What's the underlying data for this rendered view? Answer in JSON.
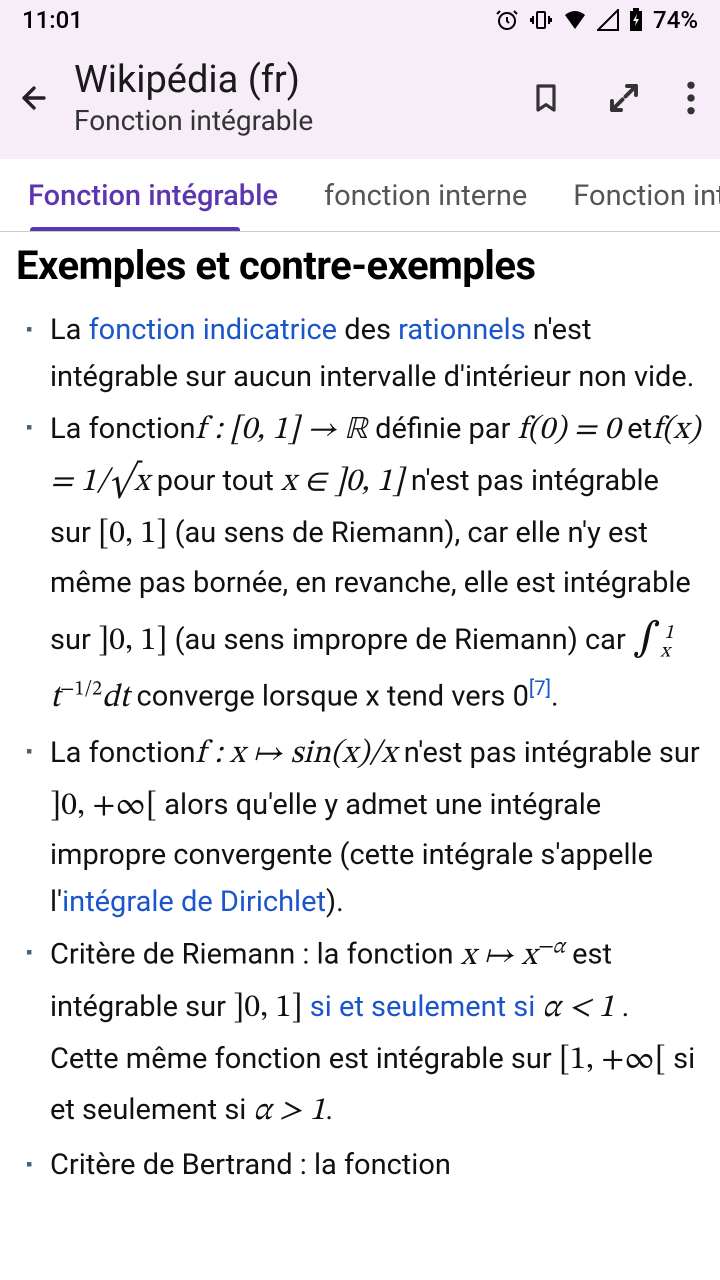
{
  "status": {
    "time": "11:01",
    "battery": "74%"
  },
  "header": {
    "site": "Wikipédia (fr)",
    "page": "Fonction intégrable"
  },
  "tabs": [
    {
      "label": "Fonction intégrable",
      "active": true
    },
    {
      "label": "fonction interne",
      "active": false
    },
    {
      "label": "Fonction intr",
      "active": false
    }
  ],
  "article": {
    "section_title": "Exemples et contre-exemples",
    "items": [
      {
        "pre": "La ",
        "link1": "fonction indicatrice",
        "mid1": " des ",
        "link2": "rationnels",
        "tail": " n'est intégrable sur aucun intervalle d'intérieur non vide."
      },
      {
        "p1": "La fonction",
        "m1": "f : [0, 1] → ℝ",
        "p2": " définie par ",
        "m2": "f(0) = 0",
        "p3": " et",
        "m3": "f(x) = 1/√x",
        "p4": " pour tout ",
        "m4": "x ∈ ]0, 1]",
        "p5": " n'est pas intégrable sur ",
        "m5": "[0, 1]",
        "p6": " (au sens de Riemann), car elle n'y est même pas bornée, en revanche, elle est intégrable sur ",
        "m6": "]0, 1]",
        "p7": " (au sens impropre de Riemann) car ",
        "m7a": "∫",
        "m7sub": "x",
        "m7sup": "1",
        "m7b": " t",
        "m7exp": "−1/2",
        "m7c": "dt",
        "p8": " converge lorsque x tend vers 0",
        "ref": "[7]",
        "p9": "."
      },
      {
        "p1": "La fonction",
        "m1": "f : x ↦ sin(x)/x",
        "p2": " n'est pas intégrable sur ",
        "m2": "]0, +∞[",
        "p3": " alors qu'elle y admet une intégrale impropre convergente (cette intégrale s'appelle l'",
        "link": "intégrale de Dirichlet",
        "p4": ")."
      },
      {
        "p1": "Critère de Riemann : la fonction ",
        "m1": "x ↦ x",
        "m1sup": "−α",
        "p2": " est intégrable sur ",
        "m2": "]0, 1]",
        "p2b": " ",
        "link": "si et seulement si",
        "p2c": " ",
        "m3": "α < 1",
        "p3": " . Cette même fonction est intégrable sur ",
        "m4": "[1, +∞[",
        "p4": " si et seulement si ",
        "m5": "α > 1",
        "p5": "."
      },
      {
        "p1": "Critère de Bertrand : la fonction"
      }
    ]
  }
}
